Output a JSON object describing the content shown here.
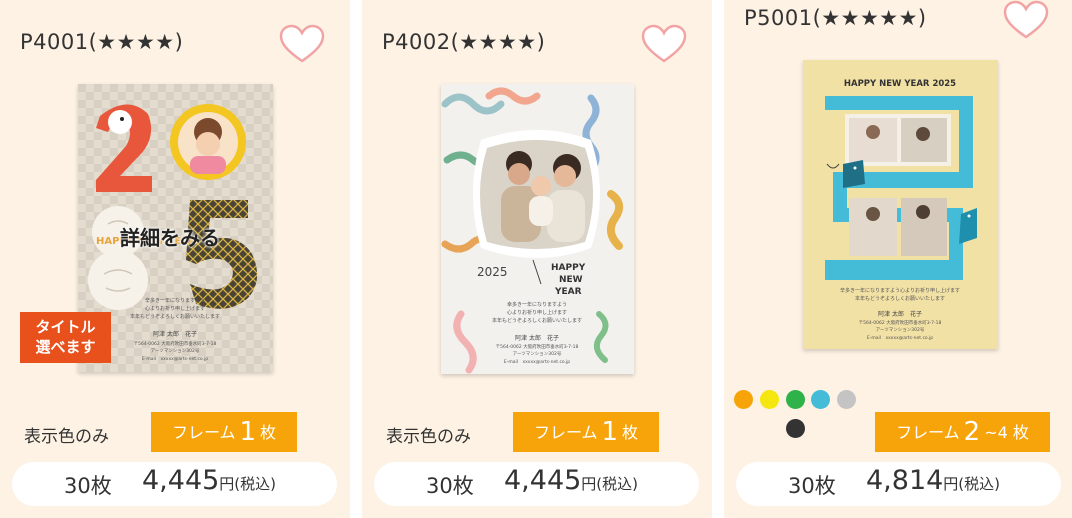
{
  "cards": [
    {
      "code": "P4001(★★★★)",
      "overlay": "詳細をみる",
      "badge_line1": "タイトル",
      "badge_line2": "選べます",
      "color_only": "表示色のみ",
      "frame_prefix": "フレーム",
      "frame_num": "1",
      "frame_suffix": "枚",
      "qty": "30枚",
      "price": "4,445",
      "unit": "円(税込)",
      "card_text": {
        "year_text": "HAPPY NEW YEAR",
        "msg1": "辛多き一年になりますよう",
        "msg2": "心よりお祈り申し上げます",
        "msg3": "本年もどうぞよろしくお願いいたします",
        "name": "阿津 太郎　花子",
        "address": "〒564-0062 大阪府吹田市垂水町3-7-18",
        "building": "アーツマンション302号",
        "email": "E-mail　xxxxx@arts-net.co.jp"
      }
    },
    {
      "code": "P4002(★★★★)",
      "color_only": "表示色のみ",
      "frame_prefix": "フレーム",
      "frame_num": "1",
      "frame_suffix": "枚",
      "qty": "30枚",
      "price": "4,445",
      "unit": "円(税込)",
      "card_text": {
        "happy": "HAPPY",
        "new": "NEW",
        "year": "YEAR",
        "year_num": "2025",
        "msg1": "幸多き一年になりますよう",
        "msg2": "心よりお祈り申し上げます",
        "msg3": "本年もどうぞよろしくお願いいたします",
        "name": "阿津 太郎　花子",
        "address": "〒564-0062 大阪府吹田市垂水町3-7-18",
        "building": "アーツマンション302号",
        "email": "E-mail　xxxxx@arts-net.co.jp"
      }
    },
    {
      "code": "P5001(★★★★★)",
      "frame_prefix": "フレーム",
      "frame_num": "2",
      "frame_suffix": "~4 枚",
      "qty": "30枚",
      "price": "4,814",
      "unit": "円(税込)",
      "swatches": [
        "#f7a40b",
        "#f5e60f",
        "#2fb24a",
        "#44bcd8",
        "#c4c4c4",
        "#333333"
      ],
      "card_text": {
        "header": "HAPPY NEW YEAR 2025",
        "msg1": "辛多き一年になりますよう心よりお祈り申し上げます",
        "msg2": "本年もどうぞよろしくお願いいたします",
        "name": "阿津 太郎　花子",
        "address": "〒564-0062 大阪府吹田市垂水町3-7-18",
        "building": "アーツマンション302号",
        "email": "E-mail　xxxxx@arts-net.co.jp"
      }
    }
  ],
  "colors": {
    "card_bg": "#fdf2e4",
    "frame_button": "#f7a40b",
    "badge": "#e8511c",
    "heart": "#f2a3a3",
    "teal": "#44bcd8"
  }
}
